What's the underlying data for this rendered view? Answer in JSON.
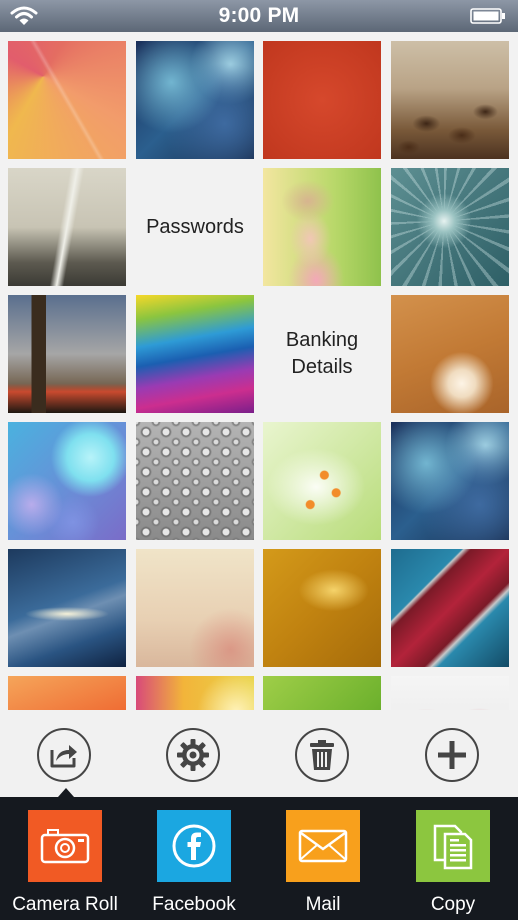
{
  "status_bar": {
    "time": "9:00 PM",
    "wifi_icon": "wifi-icon",
    "battery_icon": "battery-icon"
  },
  "grid": {
    "labels": {
      "passwords": "Passwords",
      "banking_line1": "Banking",
      "banking_line2": "Details"
    },
    "tiles": [
      "colorful-geometric-cubes",
      "blue-space-nebula",
      "orange-red-texture",
      "coffee-beans",
      "foggy-bridge",
      "passwords-folder-label",
      "woman-in-sun-hat",
      "dandelion-macro",
      "big-ben-london",
      "rainbow-waves",
      "banking-details-folder-label",
      "starfish-on-sand",
      "blue-bokeh",
      "water-droplets",
      "white-lily",
      "blue-space-nebula",
      "galaxy-planet",
      "soft-pastel-branches",
      "golden-peeling-paint",
      "red-stripe-on-blue-texture",
      "orange-red-abstract",
      "yellow-sunlight-blur",
      "green-gradient",
      "red-white-flower-blur"
    ]
  },
  "action_bar": {
    "buttons": [
      {
        "name": "share",
        "icon": "share-icon"
      },
      {
        "name": "settings",
        "icon": "gear-icon"
      },
      {
        "name": "delete",
        "icon": "trash-icon"
      },
      {
        "name": "add",
        "icon": "plus-icon"
      }
    ]
  },
  "share_sheet": {
    "items": [
      {
        "label": "Camera Roll",
        "icon": "camera-icon",
        "color": "#f15a24"
      },
      {
        "label": "Facebook",
        "icon": "facebook-icon",
        "color": "#1ba7e1"
      },
      {
        "label": "Mail",
        "icon": "mail-icon",
        "color": "#f8a01c"
      },
      {
        "label": "Copy",
        "icon": "copy-icon",
        "color": "#8cc63f"
      }
    ]
  },
  "colors": {
    "status_bar": "#6f7a89",
    "share_sheet_bg": "#15191f",
    "action_bar_bg": "#f1f1f1"
  }
}
